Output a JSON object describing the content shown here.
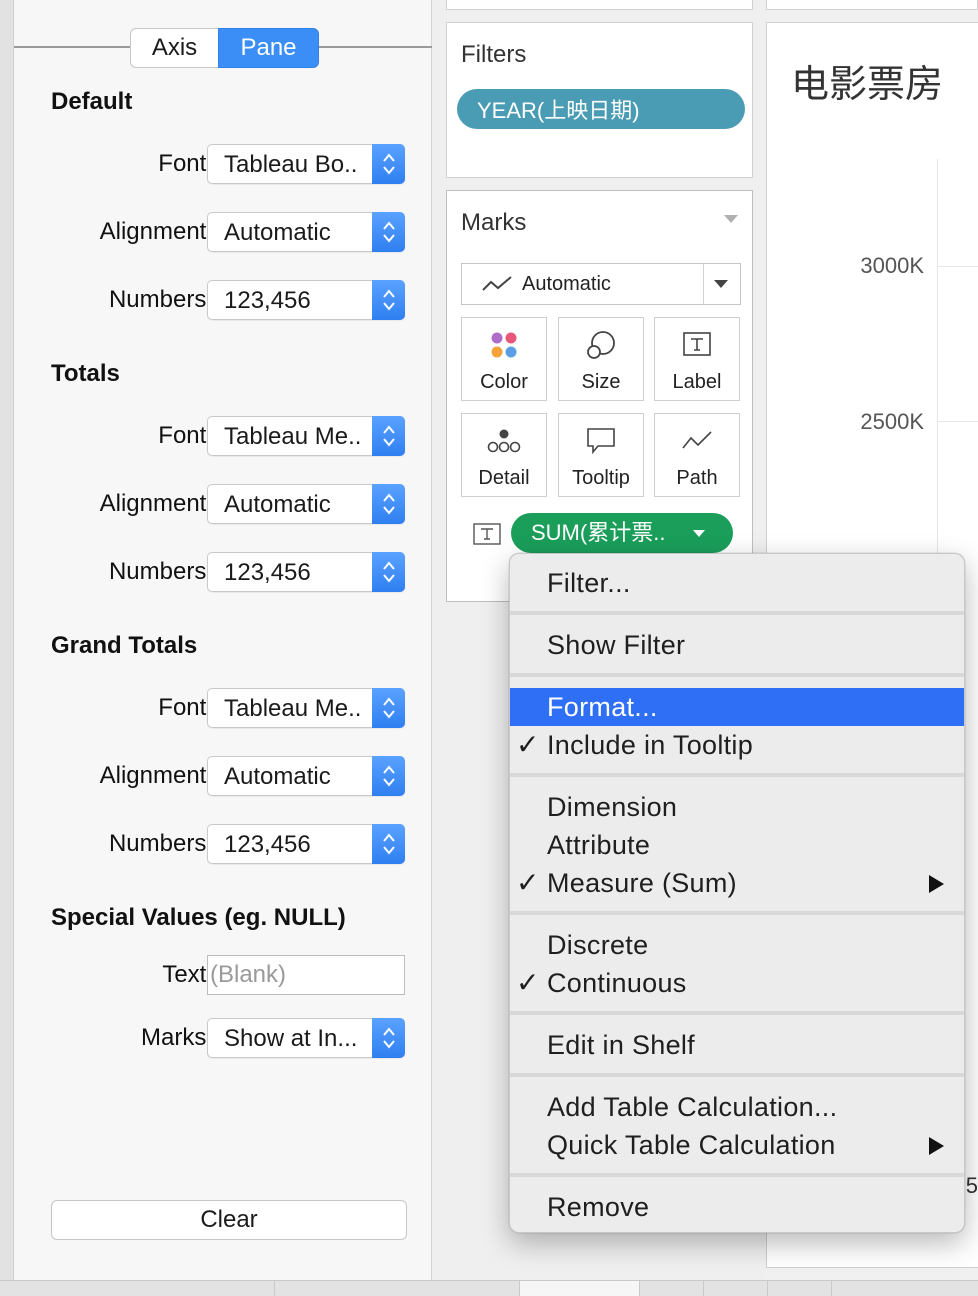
{
  "format_pane": {
    "tabs": [
      {
        "label": "Axis",
        "active": false
      },
      {
        "label": "Pane",
        "active": true
      }
    ],
    "sections": {
      "default": {
        "title": "Default",
        "font_label": "Font:",
        "font_value": "Tableau Bo..",
        "alignment_label": "Alignment:",
        "alignment_value": "Automatic",
        "numbers_label": "Numbers:",
        "numbers_value": "123,456"
      },
      "totals": {
        "title": "Totals",
        "font_label": "Font:",
        "font_value": "Tableau Me..",
        "alignment_label": "Alignment:",
        "alignment_value": "Automatic",
        "numbers_label": "Numbers:",
        "numbers_value": "123,456"
      },
      "grand_totals": {
        "title": "Grand Totals",
        "font_label": "Font:",
        "font_value": "Tableau Me..",
        "alignment_label": "Alignment:",
        "alignment_value": "Automatic",
        "numbers_label": "Numbers:",
        "numbers_value": "123,456"
      },
      "special_values": {
        "title": "Special Values (eg. NULL)",
        "text_label": "Text:",
        "text_placeholder": "(Blank)",
        "marks_label": "Marks:",
        "marks_value": "Show at In..."
      }
    },
    "clear_label": "Clear",
    "accent_color": "#3a8ef6"
  },
  "filters_card": {
    "title": "Filters",
    "pill_label": "YEAR(上映日期)",
    "pill_color": "#4a9bb4"
  },
  "marks_card": {
    "title": "Marks",
    "mark_type": "Automatic",
    "buttons": [
      {
        "label": "Color",
        "icon": "color-dots-icon"
      },
      {
        "label": "Size",
        "icon": "size-circles-icon"
      },
      {
        "label": "Label",
        "icon": "label-t-icon"
      },
      {
        "label": "Detail",
        "icon": "detail-dots-icon"
      },
      {
        "label": "Tooltip",
        "icon": "tooltip-bubble-icon"
      },
      {
        "label": "Path",
        "icon": "path-line-icon"
      }
    ],
    "field_pill": "SUM(累计票..",
    "field_pill_color": "#1a9e5a"
  },
  "view": {
    "title": "电影票房",
    "ticks": [
      "3000K",
      "2500K"
    ],
    "edge_text": "5"
  },
  "context_menu": {
    "items": {
      "filter": "Filter...",
      "show_filter": "Show Filter",
      "format": "Format...",
      "include_tooltip": "Include in Tooltip",
      "dimension": "Dimension",
      "attribute": "Attribute",
      "measure": "Measure (Sum)",
      "discrete": "Discrete",
      "continuous": "Continuous",
      "edit_shelf": "Edit in Shelf",
      "add_table_calc": "Add Table Calculation...",
      "quick_table_calc": "Quick Table Calculation",
      "remove": "Remove"
    },
    "check_glyph": "✓",
    "highlight_color": "#2f6ff5"
  }
}
